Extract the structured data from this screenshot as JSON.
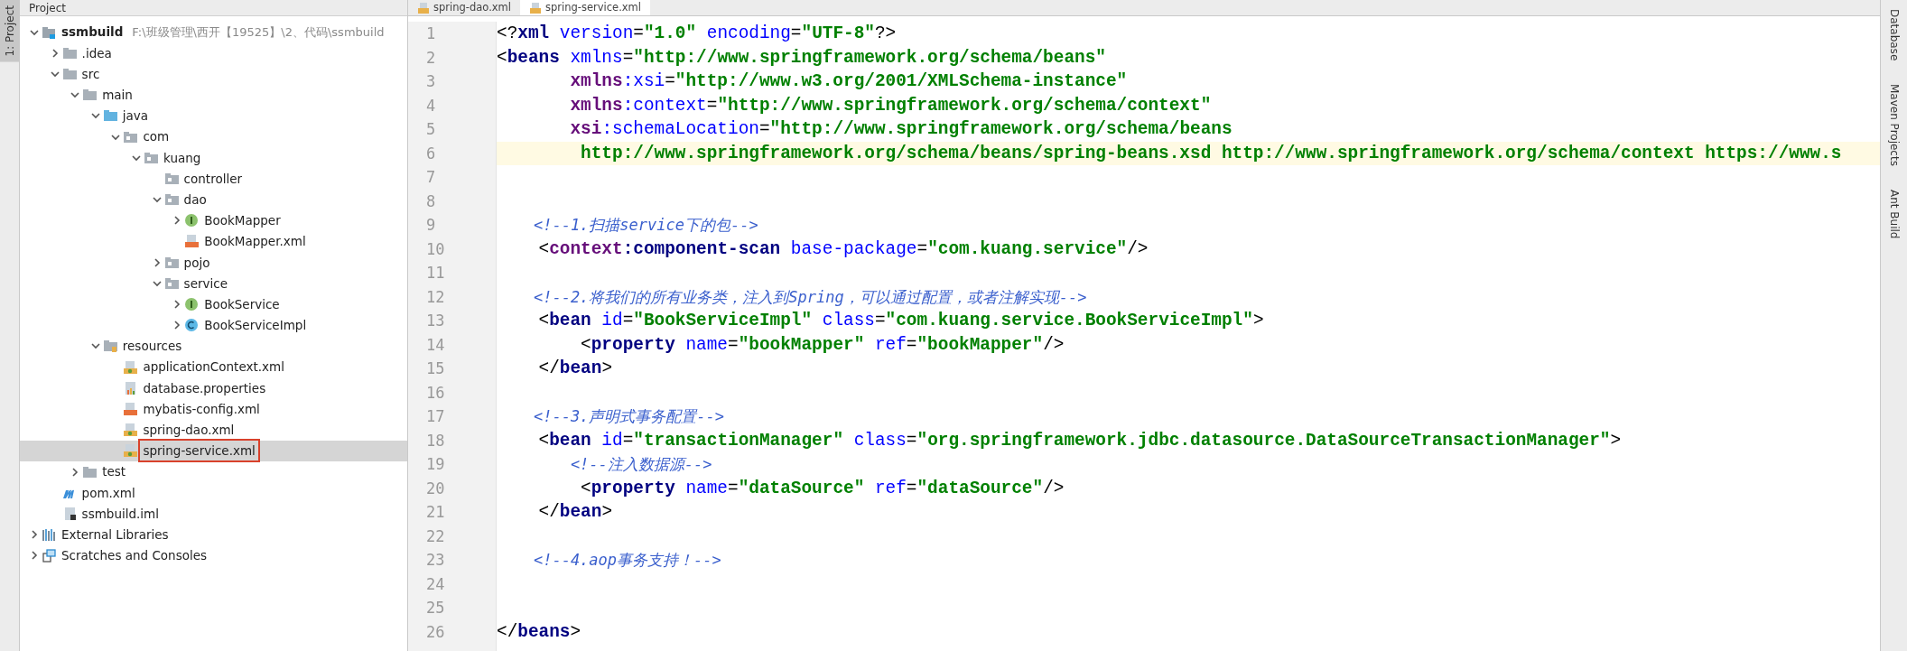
{
  "left_stripe": {
    "tabs": [
      {
        "label": "1: Project",
        "selected": true
      }
    ]
  },
  "project_panel": {
    "title": "Project",
    "tree": [
      {
        "label": "ssmbuild",
        "path": "F:\\班级管理\\西开【19525】\\2、代码\\ssmbuild",
        "kind": "module",
        "expanded": true,
        "selected": false,
        "children": [
          {
            "label": ".idea",
            "kind": "folder",
            "expanded": false,
            "selected": false
          },
          {
            "label": "src",
            "kind": "folder",
            "expanded": true,
            "selected": false,
            "children": [
              {
                "label": "main",
                "kind": "folder",
                "expanded": true,
                "selected": false,
                "children": [
                  {
                    "label": "java",
                    "kind": "source-folder",
                    "expanded": true,
                    "selected": false,
                    "children": [
                      {
                        "label": "com",
                        "kind": "package",
                        "expanded": true,
                        "selected": false,
                        "children": [
                          {
                            "label": "kuang",
                            "kind": "package",
                            "expanded": true,
                            "selected": false,
                            "children": [
                              {
                                "label": "controller",
                                "kind": "package",
                                "selected": false
                              },
                              {
                                "label": "dao",
                                "kind": "package",
                                "expanded": true,
                                "selected": false,
                                "children": [
                                  {
                                    "label": "BookMapper",
                                    "kind": "interface",
                                    "expanded": false,
                                    "selected": false
                                  },
                                  {
                                    "label": "BookMapper.xml",
                                    "kind": "xml",
                                    "selected": false
                                  }
                                ]
                              },
                              {
                                "label": "pojo",
                                "kind": "package",
                                "expanded": false,
                                "selected": false
                              },
                              {
                                "label": "service",
                                "kind": "package",
                                "expanded": true,
                                "selected": false,
                                "children": [
                                  {
                                    "label": "BookService",
                                    "kind": "interface",
                                    "expanded": false,
                                    "selected": false
                                  },
                                  {
                                    "label": "BookServiceImpl",
                                    "kind": "class",
                                    "expanded": false,
                                    "selected": false
                                  }
                                ]
                              }
                            ]
                          }
                        ]
                      }
                    ]
                  },
                  {
                    "label": "resources",
                    "kind": "resources-folder",
                    "expanded": true,
                    "selected": false,
                    "children": [
                      {
                        "label": "applicationContext.xml",
                        "kind": "spring-xml",
                        "selected": false
                      },
                      {
                        "label": "database.properties",
                        "kind": "properties",
                        "selected": false
                      },
                      {
                        "label": "mybatis-config.xml",
                        "kind": "xml",
                        "selected": false
                      },
                      {
                        "label": "spring-dao.xml",
                        "kind": "spring-xml",
                        "selected": false
                      },
                      {
                        "label": "spring-service.xml",
                        "kind": "spring-xml",
                        "selected": true
                      }
                    ]
                  }
                ]
              },
              {
                "label": "test",
                "kind": "folder",
                "expanded": false,
                "selected": false
              }
            ]
          },
          {
            "label": "pom.xml",
            "kind": "maven",
            "selected": false
          },
          {
            "label": "ssmbuild.iml",
            "kind": "iml",
            "selected": false
          }
        ]
      },
      {
        "label": "External Libraries",
        "kind": "libraries",
        "expanded": false,
        "selected": false
      },
      {
        "label": "Scratches and Consoles",
        "kind": "scratches",
        "expanded": false,
        "selected": false
      }
    ]
  },
  "editor": {
    "tabs": [
      {
        "label": "spring-dao.xml",
        "selected": false
      },
      {
        "label": "spring-service.xml",
        "selected": true
      }
    ],
    "lines": [
      {
        "number": "1",
        "current": false,
        "tokens": [
          {
            "kind": "punct",
            "text": "<?"
          },
          {
            "kind": "tag",
            "text": "xml"
          },
          {
            "kind": "attr",
            "text": " version"
          },
          {
            "kind": "punct",
            "text": "="
          },
          {
            "kind": "value",
            "text": "\"1.0\""
          },
          {
            "kind": "attr",
            "text": " encoding"
          },
          {
            "kind": "punct",
            "text": "="
          },
          {
            "kind": "value",
            "text": "\"UTF-8\""
          },
          {
            "kind": "punct",
            "text": "?>"
          }
        ]
      },
      {
        "number": "2",
        "current": false,
        "tokens": [
          {
            "kind": "punct",
            "text": "<"
          },
          {
            "kind": "tag",
            "text": "beans"
          },
          {
            "kind": "attr",
            "text": " xmlns"
          },
          {
            "kind": "punct",
            "text": "="
          },
          {
            "kind": "value",
            "text": "\"http://www.springframework.org/schema/beans\""
          }
        ]
      },
      {
        "number": "3",
        "current": false,
        "tokens": [
          {
            "kind": "ns",
            "text": "       xmlns"
          },
          {
            "kind": "attr",
            "text": ":xsi"
          },
          {
            "kind": "punct",
            "text": "="
          },
          {
            "kind": "value",
            "text": "\"http://www.w3.org/2001/XMLSchema-instance\""
          }
        ]
      },
      {
        "number": "4",
        "current": false,
        "tokens": [
          {
            "kind": "ns",
            "text": "       xmlns"
          },
          {
            "kind": "attr",
            "text": ":context"
          },
          {
            "kind": "punct",
            "text": "="
          },
          {
            "kind": "value",
            "text": "\"http://www.springframework.org/schema/context\""
          }
        ]
      },
      {
        "number": "5",
        "current": false,
        "tokens": [
          {
            "kind": "ns",
            "text": "       xsi"
          },
          {
            "kind": "attr",
            "text": ":schemaLocation"
          },
          {
            "kind": "punct",
            "text": "="
          },
          {
            "kind": "value",
            "text": "\"http://www.springframework.org/schema/beans"
          }
        ]
      },
      {
        "number": "6",
        "current": true,
        "tokens": [
          {
            "kind": "value",
            "text": "        http://www.springframework.org/schema/beans/spring-beans.xsd http://www.springframework.org/schema/context https://www.s"
          }
        ]
      },
      {
        "number": "7",
        "current": false
      },
      {
        "number": "8",
        "current": false
      },
      {
        "number": "9",
        "current": false,
        "tokens": [
          {
            "kind": "comment",
            "text": "    <!--1.扫描service下的包-->"
          }
        ]
      },
      {
        "number": "10",
        "current": false,
        "tokens": [
          {
            "kind": "punct",
            "text": "    <"
          },
          {
            "kind": "ns",
            "text": "context"
          },
          {
            "kind": "tag",
            "text": ":component-scan"
          },
          {
            "kind": "attr",
            "text": " base-package"
          },
          {
            "kind": "punct",
            "text": "="
          },
          {
            "kind": "value",
            "text": "\"com.kuang.service\""
          },
          {
            "kind": "punct",
            "text": "/>"
          }
        ]
      },
      {
        "number": "11",
        "current": false
      },
      {
        "number": "12",
        "current": false,
        "tokens": [
          {
            "kind": "comment",
            "text": "    <!--2.将我们的所有业务类，注入到Spring，可以通过配置，或者注解实现-->"
          }
        ]
      },
      {
        "number": "13",
        "current": false,
        "tokens": [
          {
            "kind": "punct",
            "text": "    <"
          },
          {
            "kind": "tag",
            "text": "bean"
          },
          {
            "kind": "attr",
            "text": " id"
          },
          {
            "kind": "punct",
            "text": "="
          },
          {
            "kind": "value",
            "text": "\"BookServiceImpl\""
          },
          {
            "kind": "attr",
            "text": " class"
          },
          {
            "kind": "punct",
            "text": "="
          },
          {
            "kind": "value",
            "text": "\"com.kuang.service.BookServiceImpl\""
          },
          {
            "kind": "punct",
            "text": ">"
          }
        ]
      },
      {
        "number": "14",
        "current": false,
        "tokens": [
          {
            "kind": "punct",
            "text": "        <"
          },
          {
            "kind": "tag",
            "text": "property"
          },
          {
            "kind": "attr",
            "text": " name"
          },
          {
            "kind": "punct",
            "text": "="
          },
          {
            "kind": "value",
            "text": "\"bookMapper\""
          },
          {
            "kind": "attr",
            "text": " ref"
          },
          {
            "kind": "punct",
            "text": "="
          },
          {
            "kind": "value",
            "text": "\"bookMapper\""
          },
          {
            "kind": "punct",
            "text": "/>"
          }
        ]
      },
      {
        "number": "15",
        "current": false,
        "tokens": [
          {
            "kind": "punct",
            "text": "    </"
          },
          {
            "kind": "tag",
            "text": "bean"
          },
          {
            "kind": "punct",
            "text": ">"
          }
        ]
      },
      {
        "number": "16",
        "current": false
      },
      {
        "number": "17",
        "current": false,
        "tokens": [
          {
            "kind": "comment",
            "text": "    <!--3.声明式事务配置-->"
          }
        ]
      },
      {
        "number": "18",
        "current": false,
        "tokens": [
          {
            "kind": "punct",
            "text": "    <"
          },
          {
            "kind": "tag",
            "text": "bean"
          },
          {
            "kind": "attr",
            "text": " id"
          },
          {
            "kind": "punct",
            "text": "="
          },
          {
            "kind": "value",
            "text": "\"transactionManager\""
          },
          {
            "kind": "attr",
            "text": " class"
          },
          {
            "kind": "punct",
            "text": "="
          },
          {
            "kind": "value",
            "text": "\"org.springframework.jdbc.datasource.DataSourceTransactionManager\""
          },
          {
            "kind": "punct",
            "text": ">"
          }
        ]
      },
      {
        "number": "19",
        "current": false,
        "tokens": [
          {
            "kind": "comment",
            "text": "        <!--注入数据源-->"
          }
        ]
      },
      {
        "number": "20",
        "current": false,
        "tokens": [
          {
            "kind": "punct",
            "text": "        <"
          },
          {
            "kind": "tag",
            "text": "property"
          },
          {
            "kind": "attr",
            "text": " name"
          },
          {
            "kind": "punct",
            "text": "="
          },
          {
            "kind": "value",
            "text": "\"dataSource\""
          },
          {
            "kind": "attr",
            "text": " ref"
          },
          {
            "kind": "punct",
            "text": "="
          },
          {
            "kind": "value",
            "text": "\"dataSource\""
          },
          {
            "kind": "punct",
            "text": "/>"
          }
        ]
      },
      {
        "number": "21",
        "current": false,
        "tokens": [
          {
            "kind": "punct",
            "text": "    </"
          },
          {
            "kind": "tag",
            "text": "bean"
          },
          {
            "kind": "punct",
            "text": ">"
          }
        ]
      },
      {
        "number": "22",
        "current": false
      },
      {
        "number": "23",
        "current": false,
        "tokens": [
          {
            "kind": "comment",
            "text": "    <!--4.aop事务支持！-->"
          }
        ]
      },
      {
        "number": "24",
        "current": false
      },
      {
        "number": "25",
        "current": false
      },
      {
        "number": "26",
        "current": false,
        "tokens": [
          {
            "kind": "punct",
            "text": "</"
          },
          {
            "kind": "tag",
            "text": "beans"
          },
          {
            "kind": "punct",
            "text": ">"
          }
        ]
      }
    ]
  },
  "right_stripe": {
    "tabs": [
      {
        "label": "Database",
        "selected": false
      },
      {
        "label": "Maven Projects",
        "selected": false
      },
      {
        "label": "Ant Build",
        "selected": false
      }
    ]
  }
}
